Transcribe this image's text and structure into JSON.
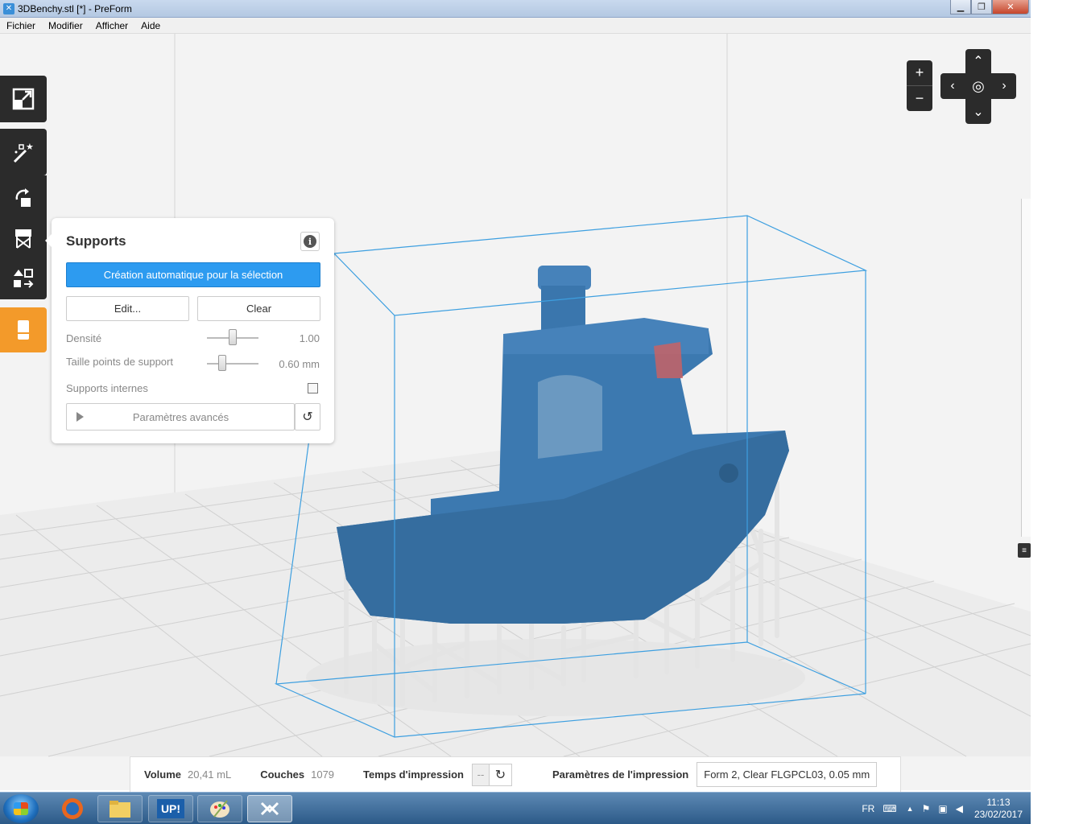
{
  "window": {
    "title": "3DBenchy.stl [*] - PreForm"
  },
  "menu": [
    "Fichier",
    "Modifier",
    "Afficher",
    "Aide"
  ],
  "toolbar": [
    {
      "name": "scale-fit-icon"
    },
    {
      "name": "magic-wand-icon"
    },
    {
      "name": "orientation-icon"
    },
    {
      "name": "supports-icon"
    },
    {
      "name": "layout-icon"
    },
    {
      "name": "print-icon"
    }
  ],
  "supports_panel": {
    "title": "Supports",
    "auto_button": "Création automatique pour la sélection",
    "edit_button": "Edit...",
    "clear_button": "Clear",
    "density_label": "Densité",
    "density_value": "1.00",
    "density_level": 0.5,
    "point_size_label": "Taille points de support",
    "point_size_value": "0.60 mm",
    "point_size_level": 0.3,
    "internal_label": "Supports internes",
    "internal_checked": false,
    "advanced_label": "Paramètres avancés"
  },
  "navigation": {
    "zoom_in": "+",
    "zoom_out": "−",
    "up": "^",
    "down": "v",
    "left": "<",
    "right": ">"
  },
  "status": {
    "volume_label": "Volume",
    "volume_value": "20,41 mL",
    "layers_label": "Couches",
    "layers_value": "1079",
    "time_label": "Temps d'impression",
    "time_value": "--",
    "settings_label": "Paramètres de l'impression",
    "settings_value": "Form 2, Clear FLGPCL03, 0.05 mm"
  },
  "taskbar": {
    "apps": [
      "Explorer",
      "Firefox",
      "Files",
      "UP!",
      "Paint",
      "PreForm"
    ],
    "up_label": "UP!",
    "lang": "FR",
    "time": "11:13",
    "date": "23/02/2017"
  },
  "colors": {
    "accent": "#2d9bf0",
    "model": "#3a77ae",
    "support": "#e6e6e6",
    "toolbar": "#2b2b2b",
    "tool_active": "#f39a2a"
  }
}
